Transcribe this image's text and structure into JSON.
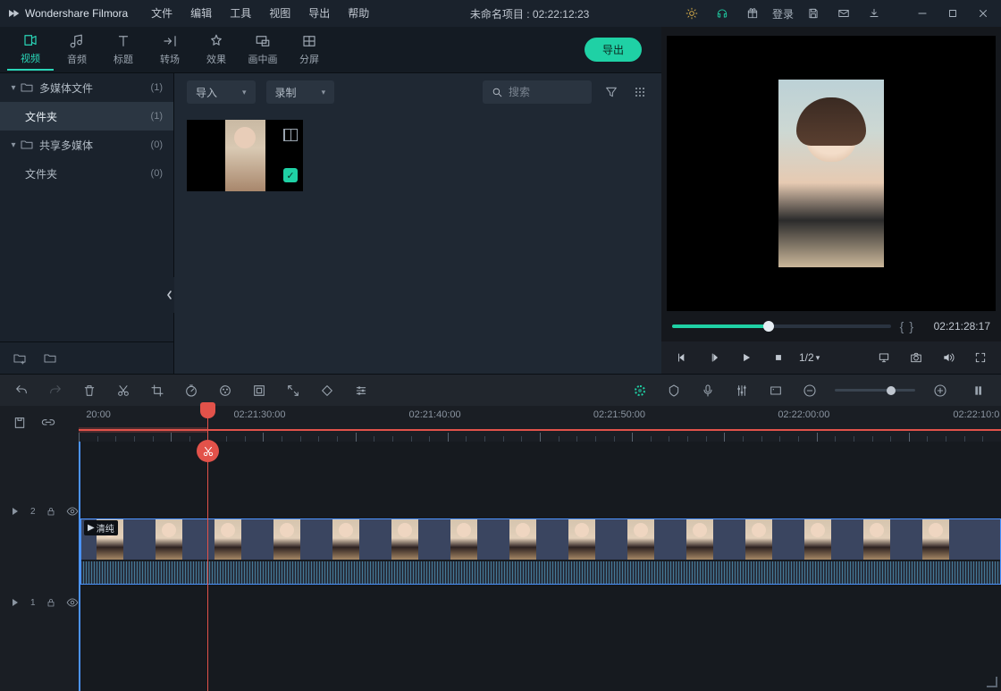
{
  "app": {
    "name": "Wondershare Filmora"
  },
  "menu": [
    "文件",
    "编辑",
    "工具",
    "视图",
    "导出",
    "帮助"
  ],
  "project": {
    "title": "未命名项目 : 02:22:12:23"
  },
  "titlebar_right": {
    "login": "登录"
  },
  "tabs": {
    "items": [
      {
        "key": "video",
        "label": "视频"
      },
      {
        "key": "audio",
        "label": "音频"
      },
      {
        "key": "title",
        "label": "标题"
      },
      {
        "key": "transition",
        "label": "转场"
      },
      {
        "key": "effect",
        "label": "效果"
      },
      {
        "key": "pip",
        "label": "画中画"
      },
      {
        "key": "split",
        "label": "分屏"
      }
    ],
    "active": "video",
    "export": "导出"
  },
  "library": {
    "tree": [
      {
        "label": "多媒体文件",
        "count": "(1)",
        "expandable": true,
        "indent": false,
        "selected": false
      },
      {
        "label": "文件夹",
        "count": "(1)",
        "expandable": false,
        "indent": true,
        "selected": true
      },
      {
        "label": "共享多媒体",
        "count": "(0)",
        "expandable": true,
        "indent": false,
        "selected": false
      },
      {
        "label": "文件夹",
        "count": "(0)",
        "expandable": false,
        "indent": true,
        "selected": false
      }
    ],
    "import_label": "导入",
    "record_label": "录制",
    "search_placeholder": "搜索"
  },
  "preview": {
    "time": "02:21:28:17",
    "speed": "1/2",
    "progress_pct": 44
  },
  "timeline": {
    "ruler_start": "20:00",
    "labels": [
      "02:21:30:00",
      "02:21:40:00",
      "02:21:50:00",
      "02:22:00:00",
      "02:22:10:0"
    ],
    "playhead_pct": 14,
    "track2": "2",
    "track1": "1",
    "clip_name": "清纯"
  },
  "colors": {
    "accent": "#1fd1a5",
    "playhead": "#e2524a"
  }
}
